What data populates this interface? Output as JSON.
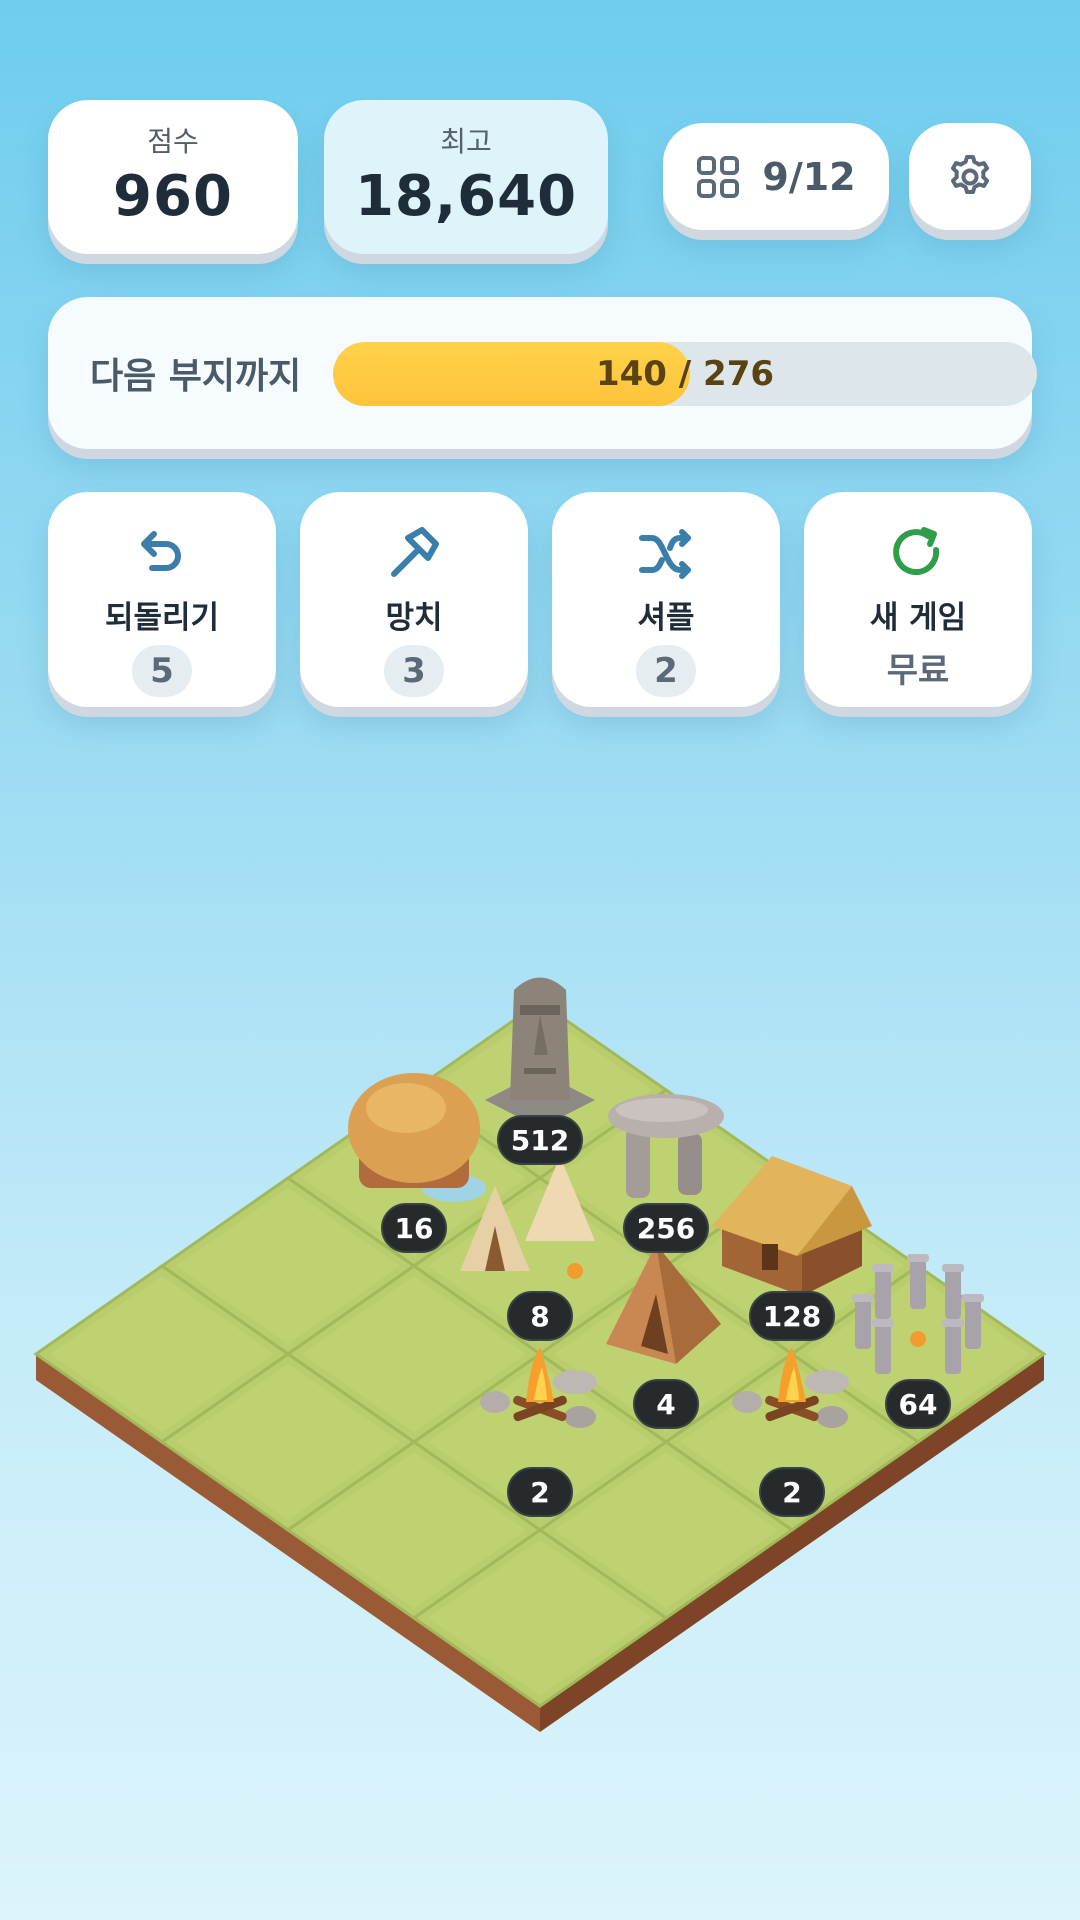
{
  "score": {
    "label": "점수",
    "value": "960"
  },
  "best": {
    "label": "최고",
    "value": "18,640"
  },
  "level": {
    "icon": "grid-icon",
    "text": "9/12"
  },
  "settings": {
    "icon": "gear-icon"
  },
  "progress": {
    "label": "다음 부지까지",
    "current": 140,
    "total": 276,
    "text": "140 / 276",
    "color": "#fcc43b"
  },
  "tools": [
    {
      "icon": "undo-icon",
      "label": "되돌리기",
      "count": "5",
      "color": "#3a7fab"
    },
    {
      "icon": "hammer-icon",
      "label": "망치",
      "count": "3",
      "color": "#3a7fab"
    },
    {
      "icon": "shuffle-icon",
      "label": "셔플",
      "count": "2",
      "color": "#3a7fab"
    },
    {
      "icon": "restart-icon",
      "label": "새 게임",
      "count": "무료",
      "color": "#2e9e4a"
    }
  ],
  "board": {
    "size": 4,
    "tiles": [
      {
        "row": 0,
        "col": 0,
        "value": "512",
        "item": "moai-statue"
      },
      {
        "row": 0,
        "col": 1,
        "value": "256",
        "item": "dolmen"
      },
      {
        "row": 0,
        "col": 2,
        "value": "128",
        "item": "longhouse"
      },
      {
        "row": 0,
        "col": 3,
        "value": "64",
        "item": "stonehenge"
      },
      {
        "row": 1,
        "col": 0,
        "value": "16",
        "item": "thatched-hut"
      },
      {
        "row": 1,
        "col": 1,
        "value": "8",
        "item": "tipi-camp"
      },
      {
        "row": 1,
        "col": 2,
        "value": "4",
        "item": "tent"
      },
      {
        "row": 1,
        "col": 3,
        "value": "2",
        "item": "campfire"
      },
      {
        "row": 2,
        "col": 0,
        "value": "",
        "item": ""
      },
      {
        "row": 2,
        "col": 1,
        "value": "",
        "item": ""
      },
      {
        "row": 2,
        "col": 2,
        "value": "2",
        "item": "campfire"
      },
      {
        "row": 2,
        "col": 3,
        "value": "",
        "item": ""
      },
      {
        "row": 3,
        "col": 0,
        "value": "",
        "item": ""
      },
      {
        "row": 3,
        "col": 1,
        "value": "",
        "item": ""
      },
      {
        "row": 3,
        "col": 2,
        "value": "",
        "item": ""
      },
      {
        "row": 3,
        "col": 3,
        "value": "",
        "item": ""
      }
    ]
  }
}
